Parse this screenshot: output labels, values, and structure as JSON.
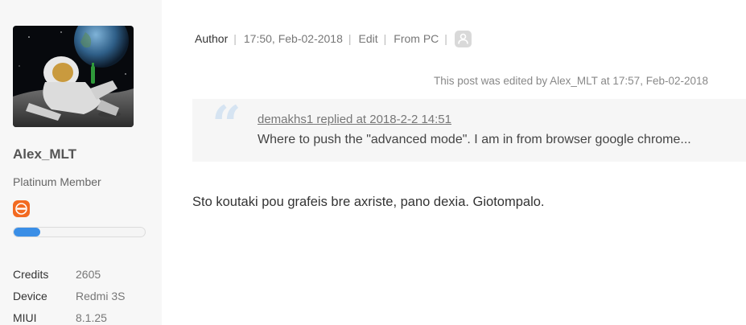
{
  "profile": {
    "avatar_alt": "astronaut-avatar",
    "username": "Alex_MLT",
    "rank": "Platinum Member",
    "level_progress": 0.2,
    "stats": [
      {
        "key": "Credits",
        "value": "2605"
      },
      {
        "key": "Device",
        "value": "Redmi 3S"
      },
      {
        "key": "MIUI",
        "value": "8.1.25"
      }
    ]
  },
  "post_meta": {
    "author_label": "Author",
    "timestamp": "17:50, Feb-02-2018",
    "edit_label": "Edit",
    "source": "From PC",
    "icon": "user-icon"
  },
  "edited_note": "This post was edited by Alex_MLT at 17:57, Feb-02-2018",
  "quote": {
    "reply_link": "demakhs1 replied at 2018-2-2 14:51",
    "text": "Where to push the \"advanced mode\". I am in from browser google chrome..."
  },
  "post_body": "Sto koutaki pou grafeis bre axriste, pano dexia. Giotompalo.",
  "colors": {
    "accent": "#3a8ee6",
    "badge": "#f26a21",
    "sidebar_bg": "#f7f7f7",
    "quote_bg": "#f6f6f6"
  }
}
